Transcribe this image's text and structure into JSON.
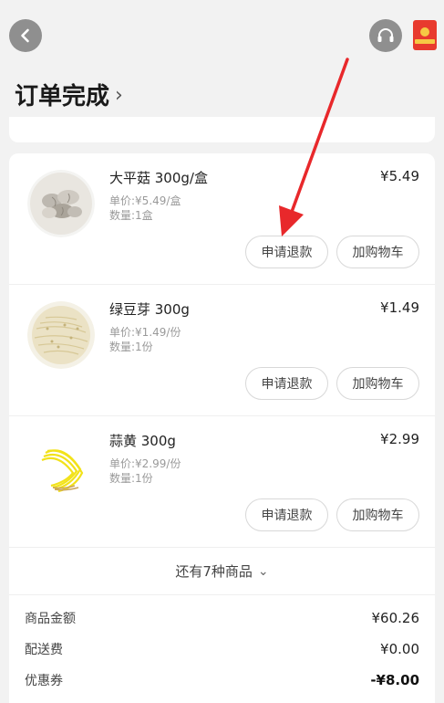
{
  "header": {
    "title": "订单完成",
    "chevron": "›",
    "back_icon": "chevron-left-icon",
    "support_icon": "headset-icon",
    "redpacket_icon": "red-packet-icon"
  },
  "items": [
    {
      "name": "大平菇 300g/盒",
      "price": "¥5.49",
      "unit_price": "单价:¥5.49/盒",
      "quantity": "数量:1盒",
      "refund_label": "申请退款",
      "cart_label": "加购物车",
      "image": "oyster-mushroom"
    },
    {
      "name": "绿豆芽 300g",
      "price": "¥1.49",
      "unit_price": "单价:¥1.49/份",
      "quantity": "数量:1份",
      "refund_label": "申请退款",
      "cart_label": "加购物车",
      "image": "mung-bean-sprouts"
    },
    {
      "name": "蒜黄 300g",
      "price": "¥2.99",
      "unit_price": "单价:¥2.99/份",
      "quantity": "数量:1份",
      "refund_label": "申请退款",
      "cart_label": "加购物车",
      "image": "yellow-chives"
    }
  ],
  "more": {
    "label": "还有7种商品",
    "chevron": "⌄"
  },
  "summary": {
    "goods_amount_label": "商品金额",
    "goods_amount": "¥60.26",
    "delivery_fee_label": "配送费",
    "delivery_fee": "¥0.00",
    "coupon_label": "优惠券",
    "coupon": "-¥8.00"
  },
  "colors": {
    "annotation_arrow": "#e8282b",
    "icon_circle": "#8f8f8f",
    "redpacket": "#e83a2e"
  }
}
